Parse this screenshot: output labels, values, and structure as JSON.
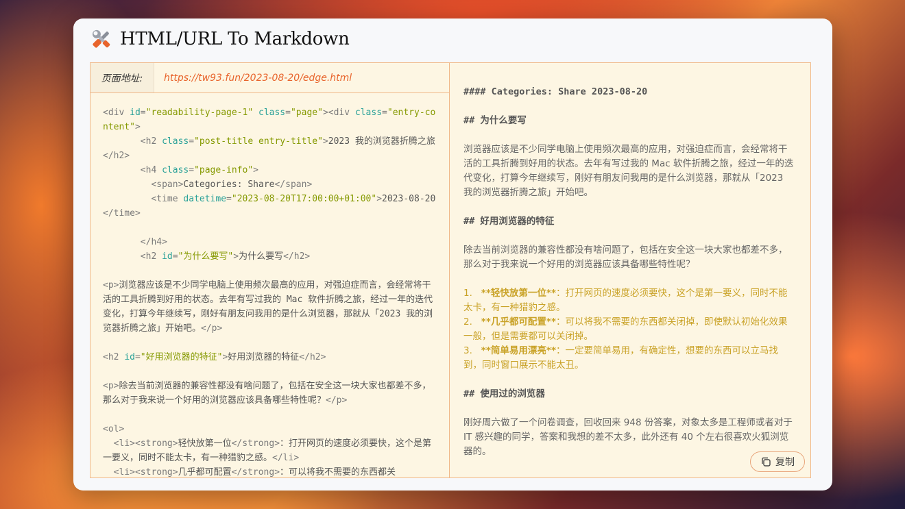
{
  "app": {
    "title": "HTML/URL To Markdown"
  },
  "url_bar": {
    "label": "页面地址:",
    "value": "https://tw93.fun/2023-08-20/edge.html"
  },
  "html_source": [
    [
      [
        "tag",
        "<div "
      ],
      [
        "attr",
        "id"
      ],
      [
        "tag",
        "="
      ],
      [
        "val",
        "\"readability-page-1\""
      ],
      [
        "tag",
        " "
      ],
      [
        "attr",
        "class"
      ],
      [
        "tag",
        "="
      ],
      [
        "val",
        "\"page\""
      ],
      [
        "tag",
        "><div "
      ],
      [
        "attr",
        "class"
      ],
      [
        "tag",
        "="
      ],
      [
        "val",
        "\"entry-content\""
      ],
      [
        "tag",
        ">"
      ]
    ],
    [
      [
        "tag",
        "       <h2 "
      ],
      [
        "attr",
        "class"
      ],
      [
        "tag",
        "="
      ],
      [
        "val",
        "\"post-title entry-title\""
      ],
      [
        "tag",
        ">"
      ],
      [
        "txt",
        "2023 我的浏览器折腾之旅"
      ],
      [
        "tag",
        "</h2>"
      ]
    ],
    [
      [
        "tag",
        "       <h4 "
      ],
      [
        "attr",
        "class"
      ],
      [
        "tag",
        "="
      ],
      [
        "val",
        "\"page-info\""
      ],
      [
        "tag",
        ">"
      ]
    ],
    [
      [
        "tag",
        "         <span>"
      ],
      [
        "txt",
        "Categories: Share"
      ],
      [
        "tag",
        "</span>"
      ]
    ],
    [
      [
        "tag",
        "         <time "
      ],
      [
        "attr",
        "datetime"
      ],
      [
        "tag",
        "="
      ],
      [
        "val",
        "\"2023-08-20T17:00:00+01:00\""
      ],
      [
        "tag",
        ">"
      ],
      [
        "txt",
        "2023-08-20"
      ],
      [
        "tag",
        "</time>"
      ]
    ],
    [
      [
        "txt",
        " "
      ]
    ],
    [
      [
        "tag",
        "       </h4>"
      ]
    ],
    [
      [
        "tag",
        "       <h2 "
      ],
      [
        "attr",
        "id"
      ],
      [
        "tag",
        "="
      ],
      [
        "val",
        "\"为什么要写\""
      ],
      [
        "tag",
        ">"
      ],
      [
        "txt",
        "为什么要写"
      ],
      [
        "tag",
        "</h2>"
      ]
    ],
    [
      [
        "txt",
        " "
      ]
    ],
    [
      [
        "tag",
        "<p>"
      ],
      [
        "txt",
        "浏览器应该是不少同学电脑上使用频次最高的应用，对强迫症而言，会经常将干活的工具折腾到好用的状态。去年有写过我的 Mac 软件折腾之旅，经过一年的迭代变化，打算今年继续写，刚好有朋友问我用的是什么浏览器，那就从「2023 我的浏览器折腾之旅」开始吧。"
      ],
      [
        "tag",
        "</p>"
      ]
    ],
    [
      [
        "txt",
        " "
      ]
    ],
    [
      [
        "tag",
        "<h2 "
      ],
      [
        "attr",
        "id"
      ],
      [
        "tag",
        "="
      ],
      [
        "val",
        "\"好用浏览器的特征\""
      ],
      [
        "tag",
        ">"
      ],
      [
        "txt",
        "好用浏览器的特征"
      ],
      [
        "tag",
        "</h2>"
      ]
    ],
    [
      [
        "txt",
        " "
      ]
    ],
    [
      [
        "tag",
        "<p>"
      ],
      [
        "txt",
        "除去当前浏览器的兼容性都没有啥问题了，包括在安全这一块大家也都差不多，那么对于我来说一个好用的浏览器应该具备哪些特性呢？"
      ],
      [
        "tag",
        "</p>"
      ]
    ],
    [
      [
        "txt",
        " "
      ]
    ],
    [
      [
        "tag",
        "<ol>"
      ]
    ],
    [
      [
        "tag",
        "  <li><strong>"
      ],
      [
        "txt",
        "轻快放第一位"
      ],
      [
        "tag",
        "</strong>"
      ],
      [
        "txt",
        "：打开网页的速度必须要快，这个是第一要义，同时不能太卡，有一种猎豹之感。"
      ],
      [
        "tag",
        "</li>"
      ]
    ],
    [
      [
        "tag",
        "  <li><strong>"
      ],
      [
        "txt",
        "几乎都可配置"
      ],
      [
        "tag",
        "</strong>"
      ],
      [
        "txt",
        "：可以将我不需要的东西都关"
      ]
    ]
  ],
  "markdown": {
    "meta_line": "#### Categories: Share 2023-08-20",
    "h_why": "## 为什么要写",
    "p_why": "浏览器应该是不少同学电脑上使用频次最高的应用，对强迫症而言，会经常将干活的工具折腾到好用的状态。去年有写过我的 Mac 软件折腾之旅，经过一年的迭代变化，打算今年继续写，刚好有朋友问我用的是什么浏览器，那就从「2023 我的浏览器折腾之旅」开始吧。",
    "h_features": "## 好用浏览器的特征",
    "p_features": "除去当前浏览器的兼容性都没有啥问题了，包括在安全这一块大家也都差不多，那么对于我来说一个好用的浏览器应该具备哪些特性呢？",
    "list": [
      {
        "num": "1.",
        "bold": "**轻快放第一位**",
        "rest": "：打开网页的速度必须要快，这个是第一要义，同时不能太卡，有一种猎豹之感。"
      },
      {
        "num": "2.",
        "bold": "**几乎都可配置**",
        "rest": "：可以将我不需要的东西都关闭掉，即使默认初始化效果一般，但是需要都可以关闭掉。"
      },
      {
        "num": "3.",
        "bold": "**简单易用漂亮**",
        "rest": "：一定要简单易用，有确定性，想要的东西可以立马找到，同时窗口展示不能太丑。"
      }
    ],
    "h_used": "## 使用过的浏览器",
    "p_used": "刚好周六做了一个问卷调查，回收回来 948 份答案，对象太多是工程师或者对于 IT 感兴趣的同学，答案和我想的差不太多，此外还有 40 个左右很喜欢火狐浏览器的。"
  },
  "copy_button": {
    "label": "复制",
    "icon": "copy-icon"
  },
  "colors": {
    "accent": "#e8642c",
    "border": "#f0b98a",
    "panel_bg": "#fdf6e3",
    "list_text": "#c9a227"
  }
}
